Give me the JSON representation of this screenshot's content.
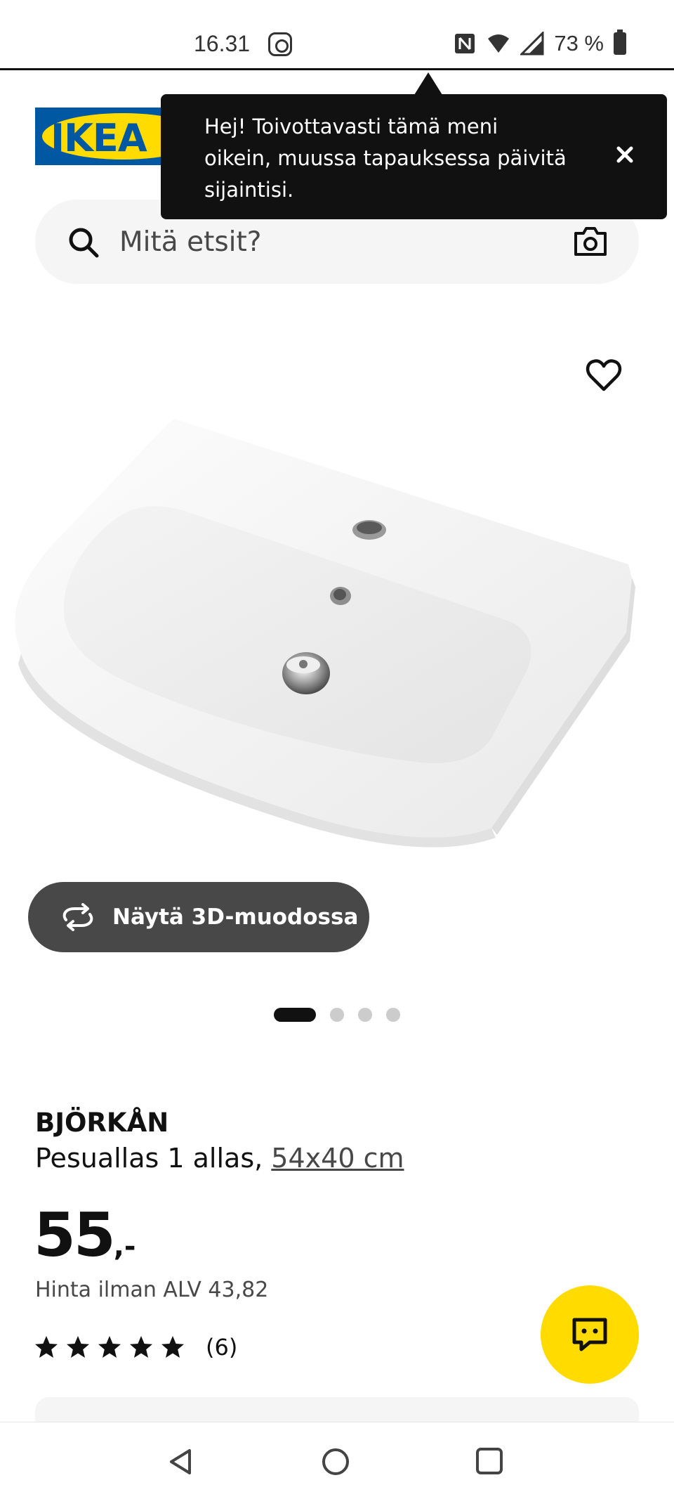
{
  "status_bar": {
    "time": "16.31",
    "battery": "73 %",
    "icons": [
      "instagram-icon",
      "nfc-icon",
      "wifi-icon",
      "signal-icon",
      "battery-icon"
    ]
  },
  "header": {
    "logo_text": "IKEA",
    "search": {
      "placeholder": "Mitä etsit?"
    }
  },
  "tooltip": {
    "text": "Hej! Toivottavasti tämä meni oikein, muussa tapauksessa päivitä sijaintisi."
  },
  "gallery": {
    "view_3d_label": "Näytä 3D-muodossa",
    "image_count": 4,
    "active_index": 0
  },
  "product": {
    "name": "BJÖRKÅN",
    "description": "Pesuallas 1 allas, ",
    "size": "54x40 cm",
    "price": "55",
    "price_suffix": ",-",
    "price_without_vat": "Hinta ilman ALV 43,82",
    "rating": 5,
    "rating_max": 5,
    "review_count": "(6)"
  },
  "colors": {
    "ikea_blue": "#0058a3",
    "ikea_yellow": "#ffdb00",
    "dark": "#111111",
    "button_gray": "#484848"
  }
}
